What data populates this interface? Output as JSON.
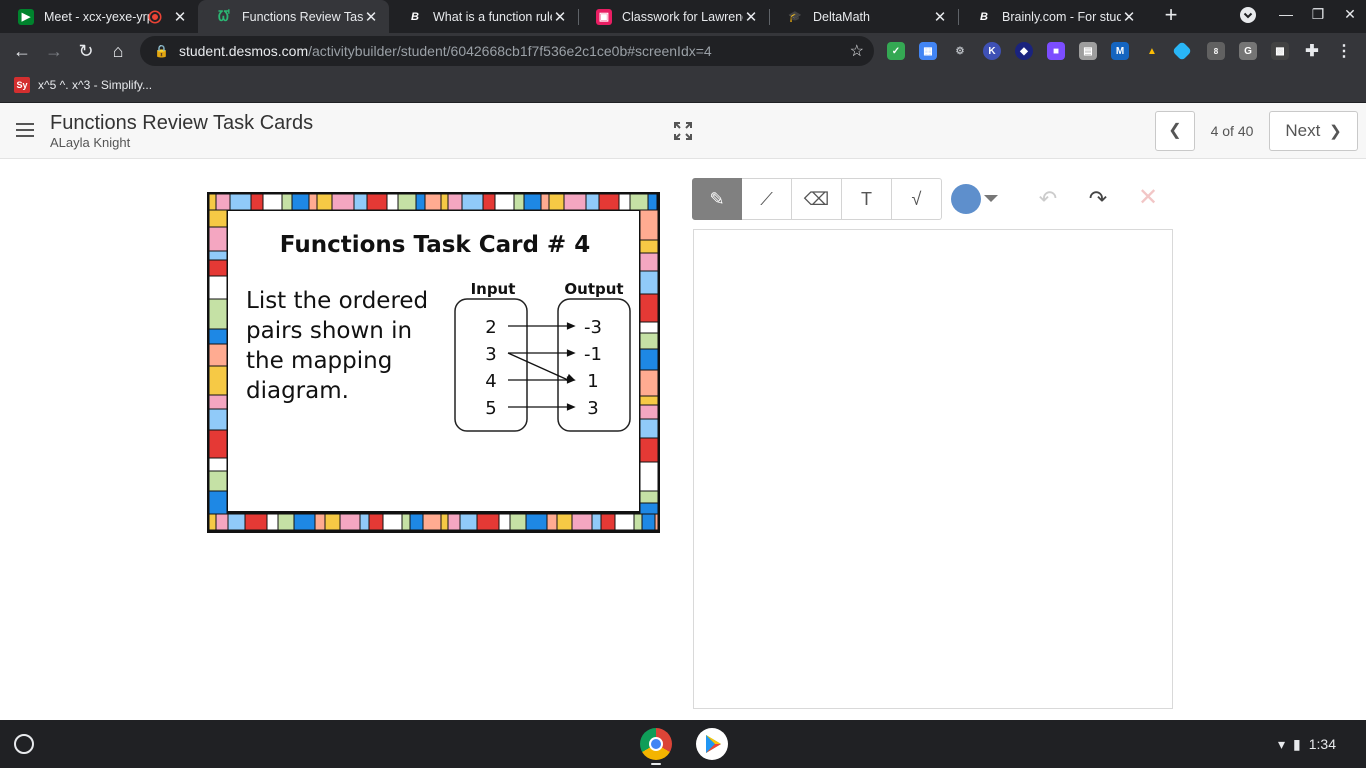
{
  "browser": {
    "tabs": [
      {
        "title": "Meet - xcx-yexe-yrp",
        "icon": "meet-icon"
      },
      {
        "title": "Functions Review Task",
        "icon": "desmos-icon"
      },
      {
        "title": "What is a function rule",
        "icon": "brainly-icon"
      },
      {
        "title": "Classwork for Lawrence",
        "icon": "classroom-icon"
      },
      {
        "title": "DeltaMath",
        "icon": "deltamath-icon"
      },
      {
        "title": "Brainly.com - For stude",
        "icon": "brainly-icon"
      }
    ],
    "url_host": "student.desmos.com",
    "url_path": "/activitybuilder/student/6042668cb1f7f536e2c1ce0b#screenIdx=4",
    "bookmarks": [
      {
        "label": "x^5 ^. x^3 - Simplify...",
        "icon_text": "Sy"
      }
    ],
    "extension_badge": "8",
    "extension_letters": {
      "k": "K",
      "m": "M",
      "g": "G"
    }
  },
  "activity": {
    "title": "Functions Review Task Cards",
    "student": "ALayla Knight",
    "page_indicator": "4 of 40",
    "next_label": "Next"
  },
  "task_card": {
    "heading": "Functions Task Card # 4",
    "prompt_lines": [
      "List the ordered",
      "pairs shown in",
      "the mapping",
      "diagram."
    ],
    "input_label": "Input",
    "output_label": "Output",
    "inputs": [
      "2",
      "3",
      "4",
      "5"
    ],
    "outputs": [
      "-3",
      "-1",
      "1",
      "3"
    ],
    "mappings": [
      [
        0,
        0
      ],
      [
        1,
        1
      ],
      [
        1,
        2
      ],
      [
        2,
        2
      ],
      [
        3,
        3
      ]
    ]
  },
  "sketch": {
    "tools": [
      {
        "name": "pencil-tool",
        "icon": "pencil-icon",
        "glyph": "✎",
        "active": true
      },
      {
        "name": "line-tool",
        "icon": "line-icon",
        "glyph": "⟋",
        "active": false
      },
      {
        "name": "eraser-tool",
        "icon": "eraser-icon",
        "glyph": "⌫",
        "active": false
      },
      {
        "name": "text-tool",
        "icon": "text-icon",
        "glyph": "T",
        "active": false
      },
      {
        "name": "math-tool",
        "icon": "sqrt-icon",
        "glyph": "√",
        "active": false
      }
    ],
    "pen_color": "#5e8fcc"
  },
  "system": {
    "time": "1:34"
  }
}
